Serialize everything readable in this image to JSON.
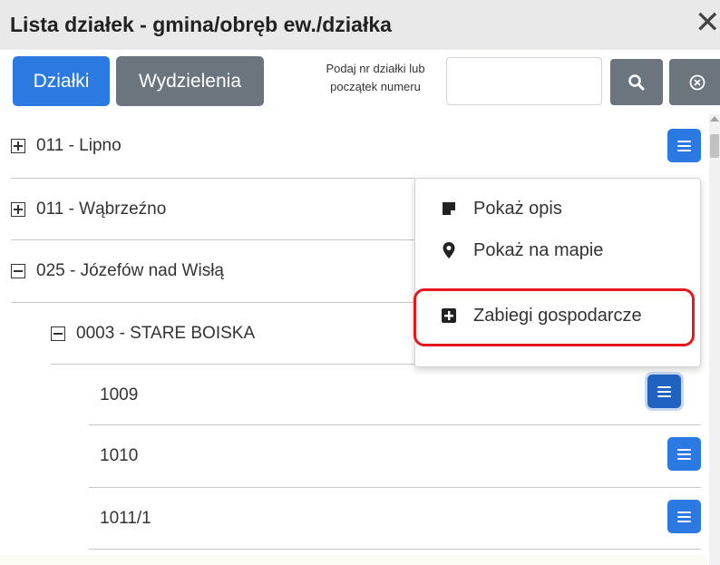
{
  "window": {
    "title": "Lista działek - gmina/obręb ew./działka",
    "close_glyph": "✕"
  },
  "toolbar": {
    "tab_active": "Działki",
    "tab_other": "Wydzielenia",
    "hint_line1": "Podaj nr działki lub",
    "hint_line2": "początek numeru",
    "search_value": "",
    "search_icon": "search-icon",
    "clear_icon": "circle-x-icon"
  },
  "tree": [
    {
      "label": "011 - Lipno",
      "state": "collapsed",
      "level": 0,
      "menu": true
    },
    {
      "label": "011 - Wąbrzeźno",
      "state": "collapsed",
      "level": 0,
      "menu": false
    },
    {
      "label": "025 - Józefów nad Wisłą",
      "state": "expanded",
      "level": 0,
      "menu": false
    },
    {
      "label": "0003 - STARE BOISKA",
      "state": "expanded",
      "level": 1,
      "menu": false
    },
    {
      "label": "1009",
      "state": "leaf",
      "level": 2,
      "menu": true,
      "active": true
    },
    {
      "label": "1010",
      "state": "leaf",
      "level": 2,
      "menu": true
    },
    {
      "label": "1011/1",
      "state": "leaf",
      "level": 2,
      "menu": true
    }
  ],
  "dropdown": {
    "items": [
      {
        "label": "Pokaż opis",
        "icon": "note-icon"
      },
      {
        "label": "Pokaż na mapie",
        "icon": "map-marker-icon"
      },
      {
        "label": "Zabiegi gospodarcze",
        "icon": "plus-square-icon",
        "highlighted": true
      }
    ]
  },
  "colors": {
    "primary": "#2a7ae2",
    "secondary": "#6c757d",
    "highlight": "#e8171b"
  }
}
